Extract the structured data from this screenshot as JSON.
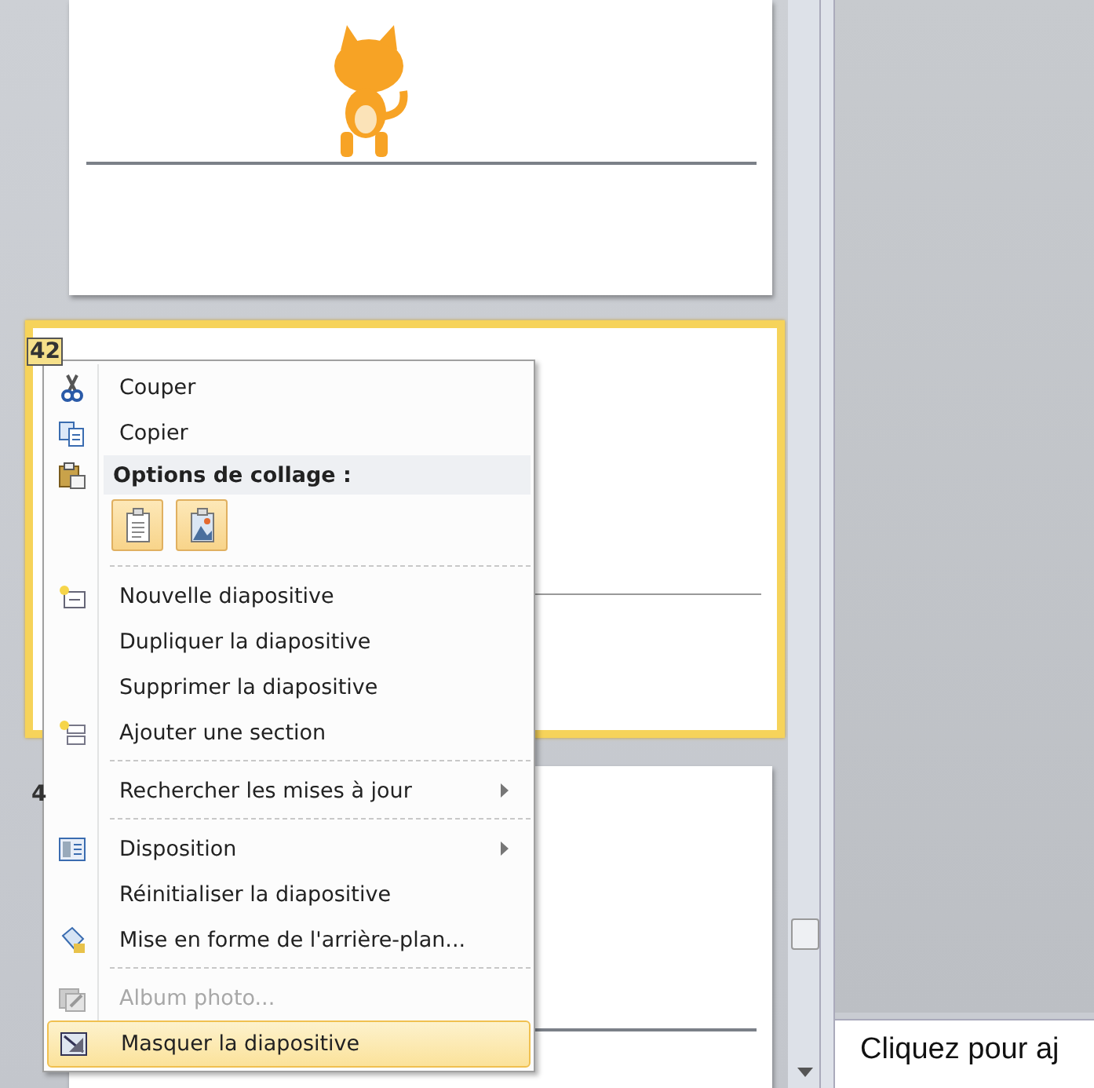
{
  "slides": [
    {
      "picture": true,
      "selected": false
    },
    {
      "number": "42",
      "selected": true
    },
    {
      "number": "4",
      "selected": false
    }
  ],
  "context_menu": {
    "items": [
      {
        "kind": "item",
        "label": "Couper",
        "submenu": false,
        "disabled": false,
        "selected": false
      },
      {
        "kind": "item",
        "label": "Copier",
        "submenu": false,
        "disabled": false,
        "selected": false
      },
      {
        "kind": "header",
        "label": "Options de collage :"
      },
      {
        "kind": "paste-options"
      },
      {
        "kind": "separator"
      },
      {
        "kind": "item",
        "label": "Nouvelle diapositive",
        "submenu": false,
        "disabled": false,
        "selected": false
      },
      {
        "kind": "item",
        "label": "Dupliquer la diapositive",
        "submenu": false,
        "disabled": false,
        "selected": false
      },
      {
        "kind": "item",
        "label": "Supprimer la diapositive",
        "submenu": false,
        "disabled": false,
        "selected": false
      },
      {
        "kind": "item",
        "label": "Ajouter une section",
        "submenu": false,
        "disabled": false,
        "selected": false
      },
      {
        "kind": "separator"
      },
      {
        "kind": "item",
        "label": "Rechercher les mises à jour",
        "submenu": true,
        "disabled": false,
        "selected": false
      },
      {
        "kind": "separator"
      },
      {
        "kind": "item",
        "label": "Disposition",
        "submenu": true,
        "disabled": false,
        "selected": false
      },
      {
        "kind": "item",
        "label": "Réinitialiser la diapositive",
        "submenu": false,
        "disabled": false,
        "selected": false
      },
      {
        "kind": "item",
        "label": "Mise en forme de l'arrière-plan...",
        "submenu": false,
        "disabled": false,
        "selected": false
      },
      {
        "kind": "separator"
      },
      {
        "kind": "item",
        "label": "Album photo...",
        "submenu": false,
        "disabled": true,
        "selected": false
      },
      {
        "kind": "item",
        "label": "Masquer la diapositive",
        "submenu": false,
        "disabled": false,
        "selected": true
      }
    ]
  },
  "notes": {
    "placeholder": "Cliquez pour aj"
  }
}
